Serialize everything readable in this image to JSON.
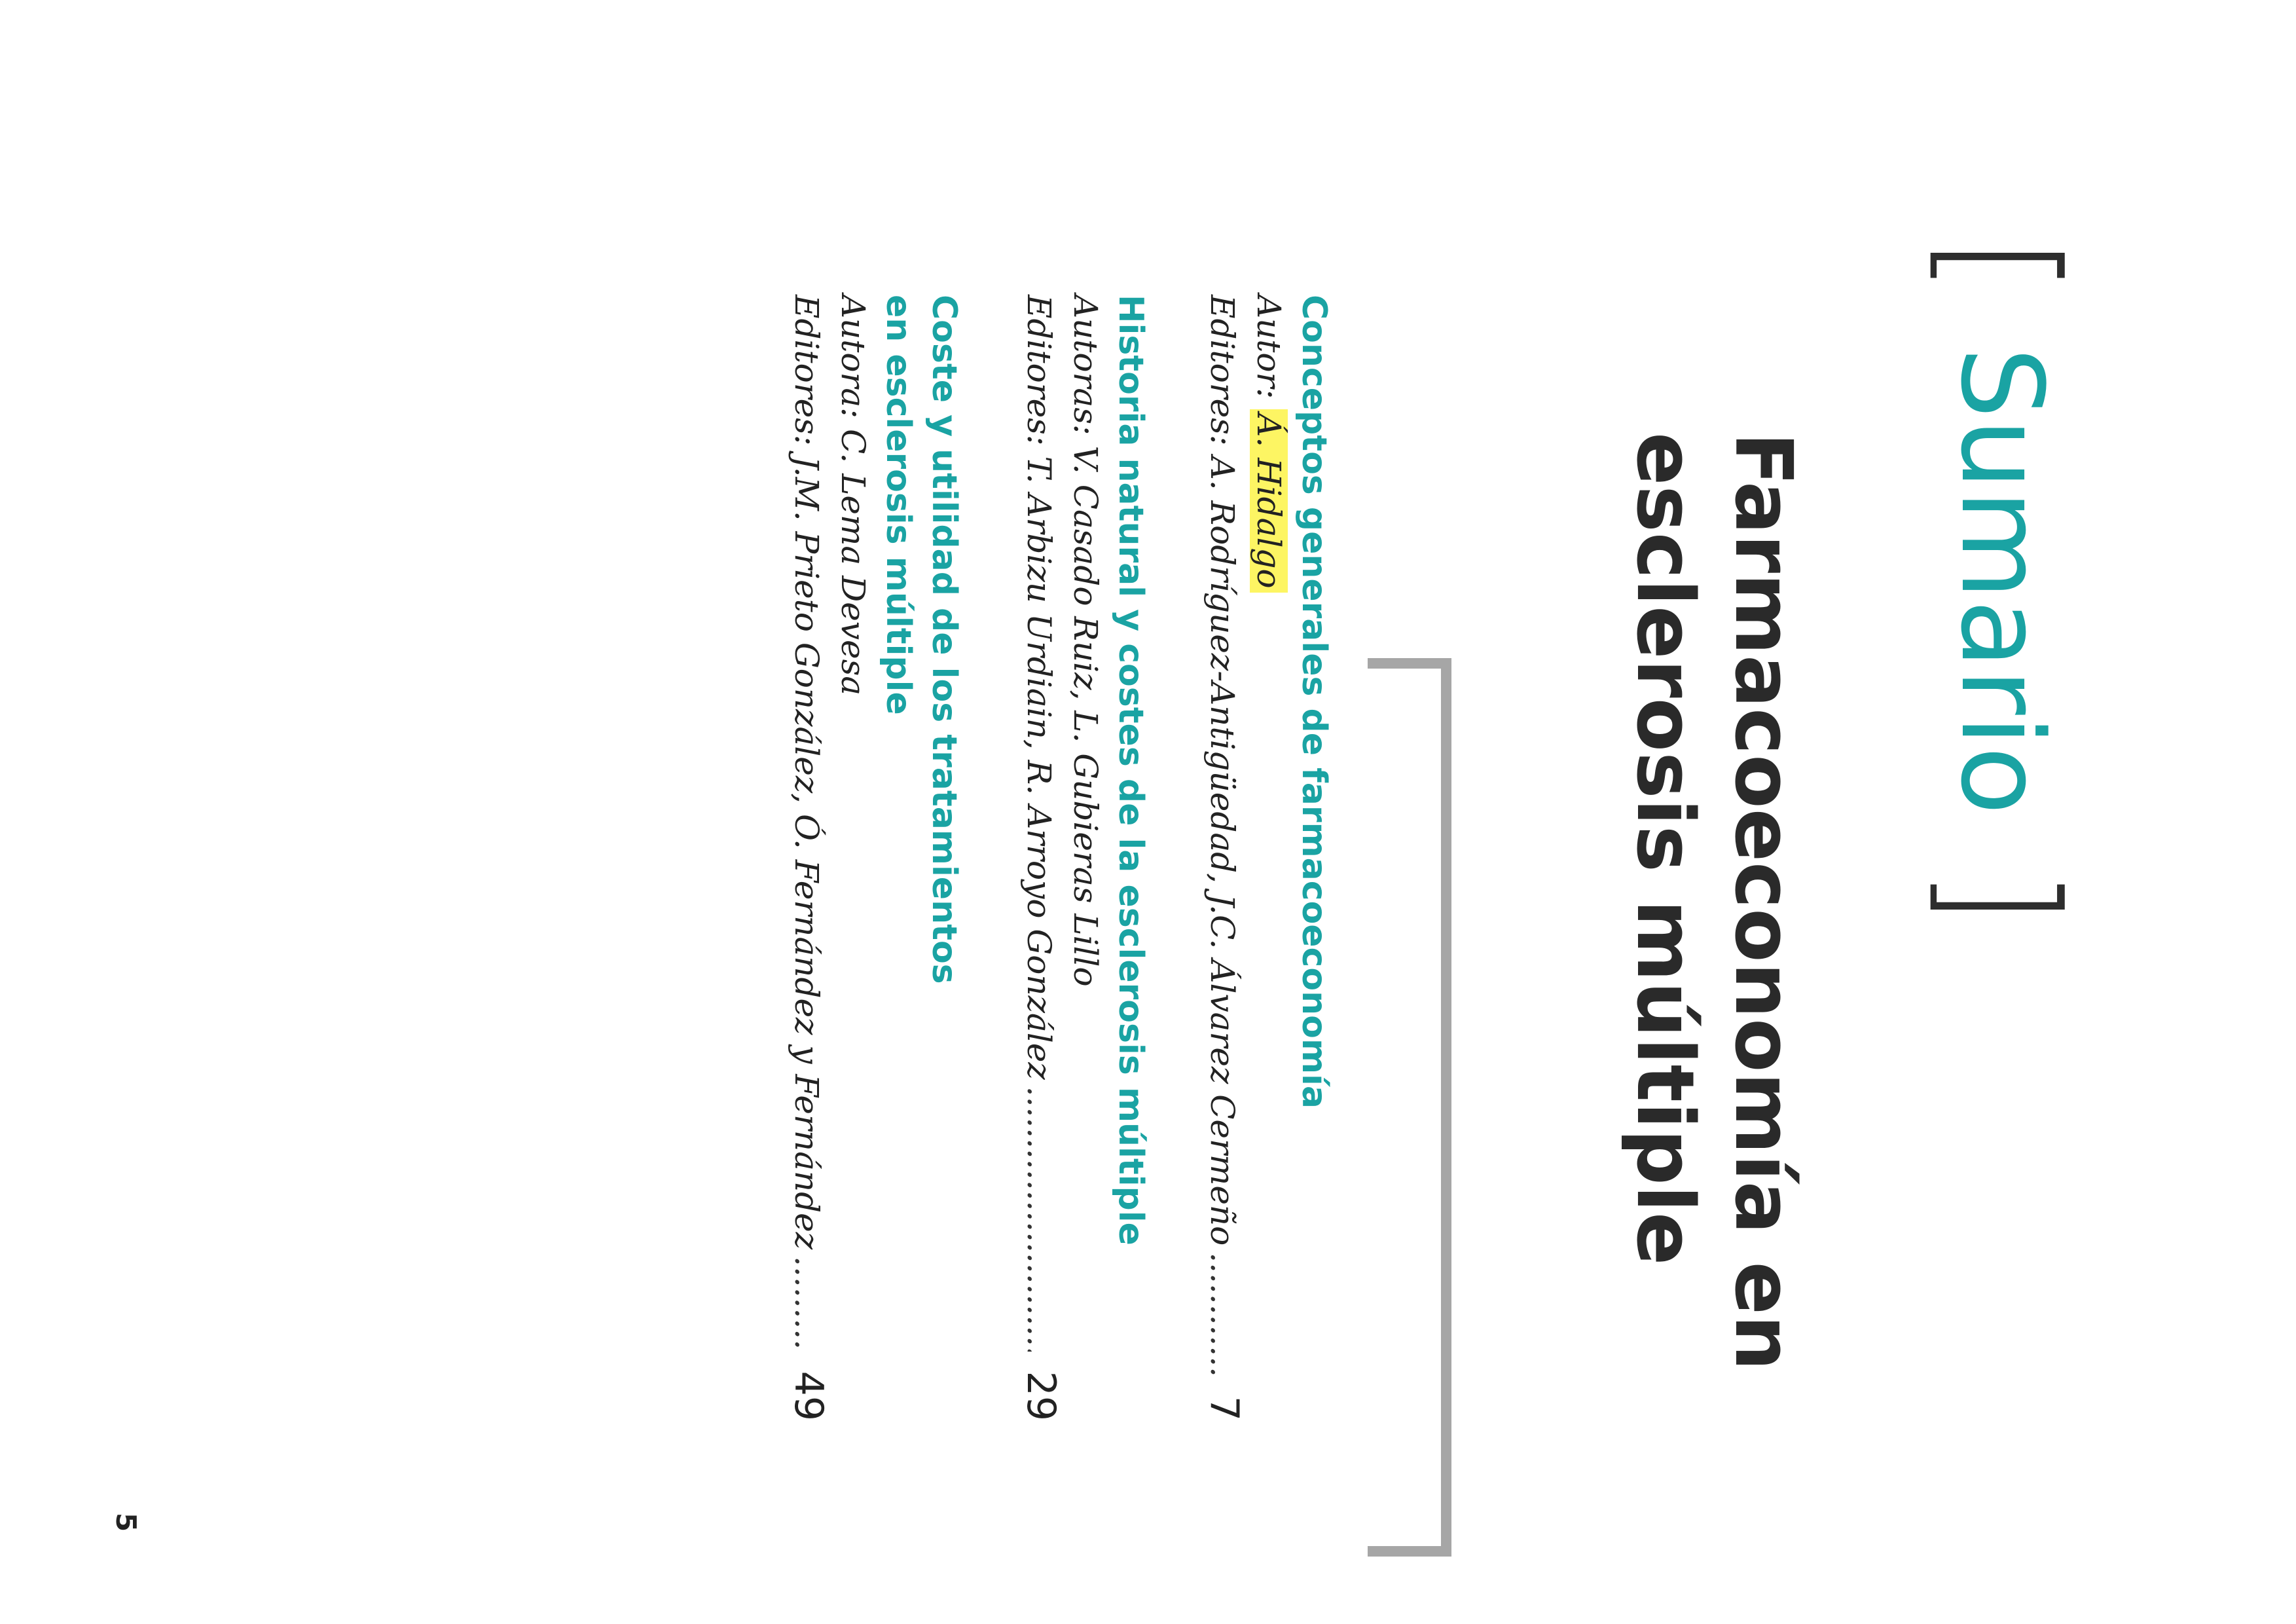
{
  "header": {
    "bracket_open": "[",
    "bracket_close": "]",
    "title": "Sumario",
    "subtitle_line1": "Farmacoeconomía en",
    "subtitle_line2": "esclerosis múltiple"
  },
  "entries": [
    {
      "title": "Conceptos generales de farmacoeconomía",
      "author_prefix": "Autor:",
      "author_name": "Á. Hidalgo",
      "editors": "Editores: A. Rodríguez-Antigüedad, J.C. Álvarez Cermeño",
      "dots": "...........................................................................",
      "page": "7"
    },
    {
      "title": "Historia natural y costes de la esclerosis múltiple",
      "authors": "Autoras: V. Casado Ruiz, L. Gubieras Lillo",
      "editors": "Editores: T. Arbizu Urdiain, R. Arroyo González",
      "dots": "...........................................................................",
      "page": "29"
    },
    {
      "title_line1": "Coste y utilidad de los tratamientos",
      "title_line2": "en esclerosis múltiple",
      "authors": "Autora: C. Lema Devesa",
      "editors": "Editores: J.M. Prieto González, Ó. Fernández y Fernández",
      "dots": "...........................................................................",
      "page": "49"
    }
  ],
  "folio": "5",
  "colors": {
    "accent": "#1aa3a3",
    "highlight": "#fdf563",
    "rule": "#a6a6a6"
  }
}
